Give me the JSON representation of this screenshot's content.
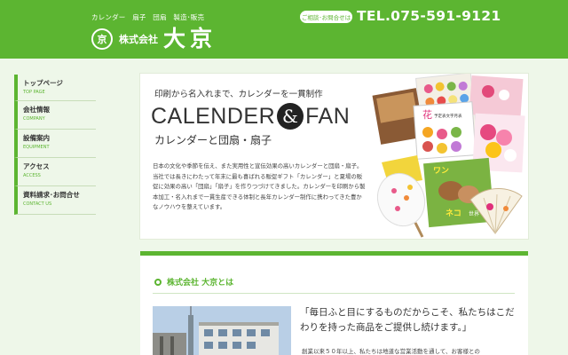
{
  "header": {
    "tagline": "カレンダー　扇子　団扇　製造･販売",
    "logo_mark": "京",
    "company_prefix": "株式会社",
    "company_name": "大京",
    "contact_label": "ご相談･お問合せは",
    "tel": "TEL.075-591-9121"
  },
  "sidebar": {
    "items": [
      {
        "label": "トップページ",
        "sub": "TOP PAGE"
      },
      {
        "label": "会社情報",
        "sub": "COMPANY"
      },
      {
        "label": "設備案内",
        "sub": "EQUIPMENT"
      },
      {
        "label": "アクセス",
        "sub": "ACCESS"
      },
      {
        "label": "資料請求･お問合せ",
        "sub": "CONTACT US"
      }
    ]
  },
  "hero": {
    "subtitle": "印刷から名入れまで、カレンダーを一貫制作",
    "title_left": "CALENDER",
    "title_amp": "&",
    "title_right": "FAN",
    "title_jp": "カレンダーと団扇・扇子",
    "body": "日本の文化や季節を伝え、また実用性と宣伝効果の高いカレンダーと団扇・扇子。当社では長きにわたって年末に最も喜ばれる販促ギフト「カレンダー」と夏場の販促に効果の高い「団扇」「扇子」を作りつづけてきました。カレンダーを印刷から製本加工・名入れまで一貫生産できる体制と長年カレンダー制作に携わってきた豊かなノウハウを整えています。",
    "collage_texts": [
      "花",
      "予定表文字月表",
      "ワン",
      "ネコ",
      "世界"
    ]
  },
  "section": {
    "title": "株式会社 大京とは",
    "quote": "「毎日ふと目にするものだからこそ、私たちはこだわりを持った商品をご提供し続けます。」",
    "body": "創業以来５０年以上、私たちは地道な営業活動を通して、お客様との"
  },
  "colors": {
    "brand_green": "#5cb531",
    "page_bg": "#eef7e9"
  }
}
